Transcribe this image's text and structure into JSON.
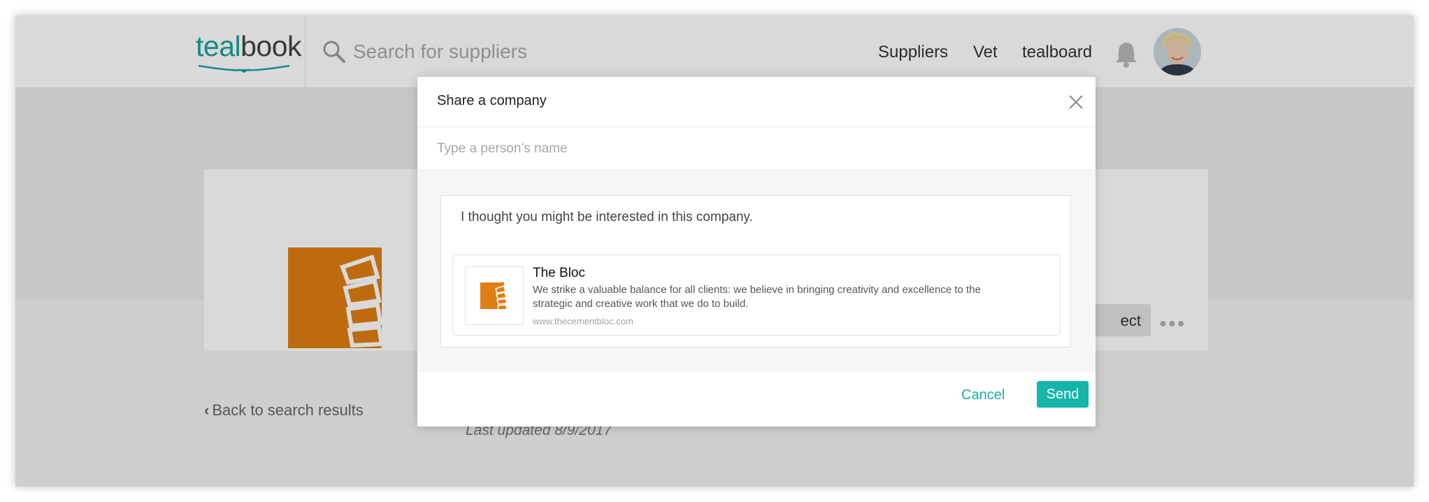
{
  "app": {
    "logo_prefix": "teal",
    "logo_suffix": "book"
  },
  "header": {
    "search_placeholder": "Search for suppliers",
    "nav": [
      "Suppliers",
      "Vet",
      "tealboard"
    ],
    "icons": {
      "search": "search-icon",
      "notifications": "bell-icon",
      "avatar": "user-avatar"
    }
  },
  "background": {
    "connect_label_partial": "ect",
    "back_label": "Back to search results",
    "last_updated": "Last updated 8/9/2017"
  },
  "modal": {
    "title": "Share a company",
    "recipient_placeholder": "Type a person’s name",
    "message": "I thought you might be interested in this company.",
    "company": {
      "name": "The Bloc",
      "description": "We strike a valuable balance for all clients: we believe in bringing creativity and excellence to the strategic and creative work that we do to build.",
      "url": "www.thecementbloc.com"
    },
    "cancel_label": "Cancel",
    "send_label": "Send"
  },
  "colors": {
    "accent": "#16b5aa",
    "brand_orange": "#e07e12",
    "logo_teal": "#1aa39e"
  }
}
